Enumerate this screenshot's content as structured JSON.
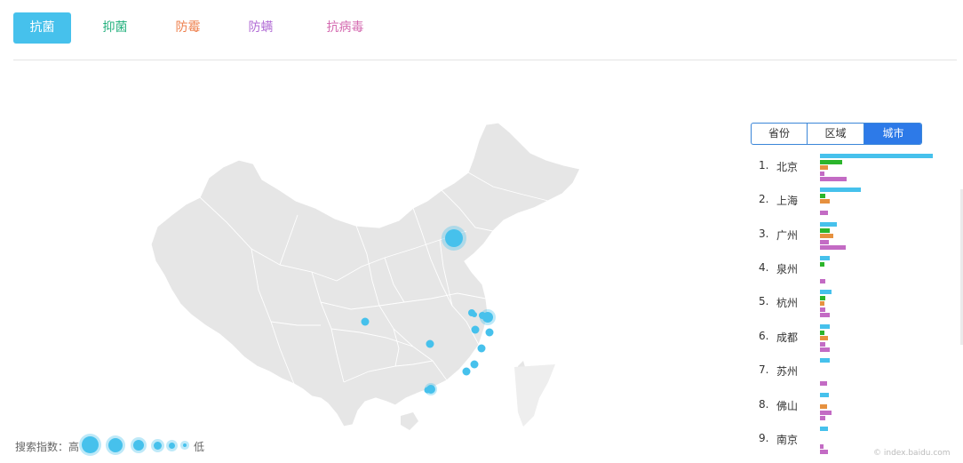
{
  "colors": {
    "accent": "#46c1ec",
    "city_tab_active": "#2d7ae8",
    "bar_kangjun": "#46c1ec",
    "bar_yijun": "#2bb52b",
    "bar_fangmei": "#e6913f",
    "bar_fangman": "#c36bc4",
    "map_fill": "#e6e6e6"
  },
  "top_tabs": [
    {
      "label": "抗菌",
      "color": "#ffffff",
      "active": true
    },
    {
      "label": "抑菌",
      "color": "#23b07d",
      "active": false
    },
    {
      "label": "防霉",
      "color": "#ee7f4c",
      "active": false
    },
    {
      "label": "防螨",
      "color": "#b06ad4",
      "active": false
    },
    {
      "label": "抗病毒",
      "color": "#d46ab0",
      "active": false
    }
  ],
  "legend": {
    "high": "搜索指数：高",
    "low": "低"
  },
  "region_tabs": [
    {
      "label": "省份",
      "active": false
    },
    {
      "label": "区域",
      "active": false
    },
    {
      "label": "城市",
      "active": true
    }
  ],
  "ranking": [
    {
      "rank": "1.",
      "city": "北京",
      "values": [
        1.0,
        0.2,
        0.07,
        0.04,
        0.24
      ]
    },
    {
      "rank": "2.",
      "city": "上海",
      "values": [
        0.36,
        0.05,
        0.09,
        0.0,
        0.07
      ]
    },
    {
      "rank": "3.",
      "city": "广州",
      "values": [
        0.15,
        0.09,
        0.12,
        0.08,
        0.23
      ]
    },
    {
      "rank": "4.",
      "city": "泉州",
      "values": [
        0.09,
        0.04,
        0.0,
        0.0,
        0.05
      ]
    },
    {
      "rank": "5.",
      "city": "杭州",
      "values": [
        0.1,
        0.05,
        0.04,
        0.05,
        0.09
      ]
    },
    {
      "rank": "6.",
      "city": "成都",
      "values": [
        0.09,
        0.04,
        0.07,
        0.05,
        0.09
      ]
    },
    {
      "rank": "7.",
      "city": "苏州",
      "values": [
        0.09,
        0.0,
        0.0,
        0.0,
        0.06
      ]
    },
    {
      "rank": "8.",
      "city": "佛山",
      "values": [
        0.08,
        0.0,
        0.06,
        0.1,
        0.05
      ]
    },
    {
      "rank": "9.",
      "city": "南京",
      "values": [
        0.07,
        0.0,
        0.0,
        0.03,
        0.07
      ]
    }
  ],
  "footer": "© index.baidu.com"
}
